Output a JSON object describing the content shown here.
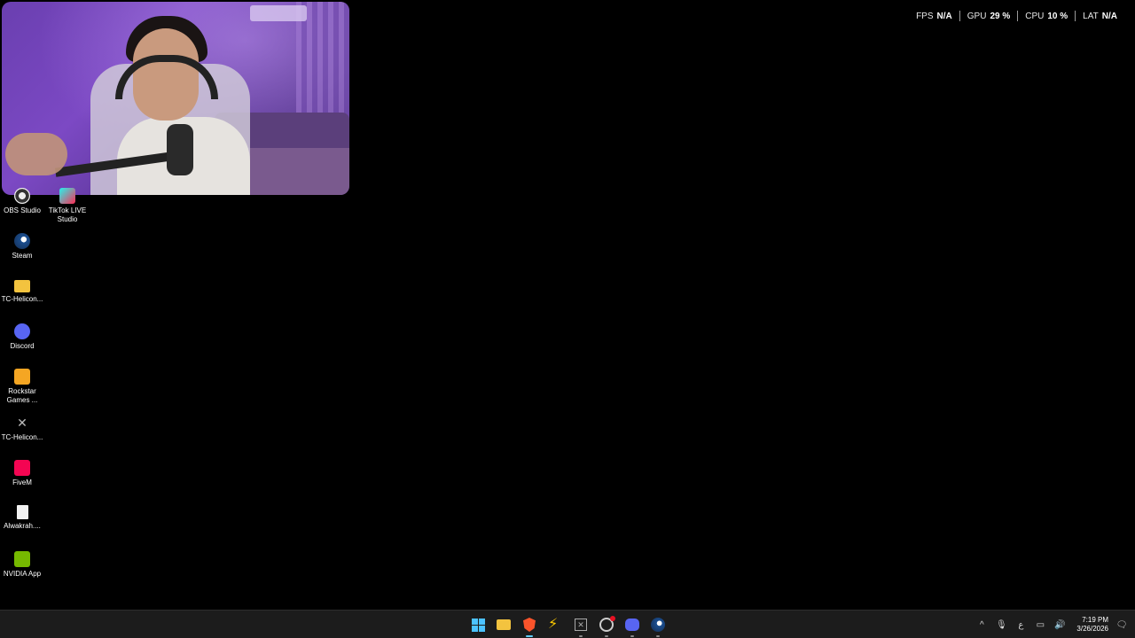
{
  "perf_overlay": {
    "items": [
      {
        "label": "FPS",
        "value": "N/A"
      },
      {
        "label": "GPU",
        "value": "29 %"
      },
      {
        "label": "CPU",
        "value": "10 %"
      },
      {
        "label": "LAT",
        "value": "N/A"
      }
    ]
  },
  "desktop_icons": [
    {
      "label": "OBS Studio",
      "icon": "obs-icon"
    },
    {
      "label": "TikTok LIVE Studio",
      "icon": "tiktok-live-icon"
    },
    {
      "label": "Steam",
      "icon": "steam-icon"
    },
    {
      "label": "TC-Helicon...",
      "icon": "folder-icon"
    },
    {
      "label": "Discord",
      "icon": "discord-icon"
    },
    {
      "label": "Rockstar Games ...",
      "icon": "rockstar-icon"
    },
    {
      "label": "TC-Helicon...",
      "icon": "x-app-icon"
    },
    {
      "label": "FiveM",
      "icon": "fivem-icon"
    },
    {
      "label": "Alwakrah....",
      "icon": "file-icon"
    },
    {
      "label": "NVIDIA App",
      "icon": "nvidia-icon"
    }
  ],
  "taskbar": {
    "apps": [
      "start-icon",
      "file-explorer-icon",
      "brave-icon",
      "feather-icon",
      "x-app-icon",
      "clock-app-icon",
      "discord-icon",
      "steam-icon"
    ],
    "tray": {
      "chevron": "^",
      "language": "ع",
      "time": "7:19 PM",
      "date": "3/26/2026"
    }
  }
}
